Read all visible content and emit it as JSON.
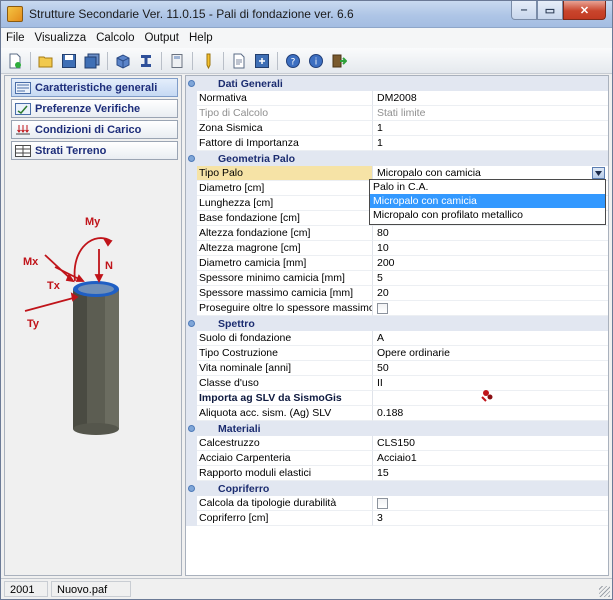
{
  "window": {
    "title": "Strutture Secondarie Ver. 11.0.15 - Pali di fondazione ver. 6.6",
    "min_label": "‒",
    "max_label": "▭",
    "close_label": "✕"
  },
  "menu": [
    "File",
    "Visualizza",
    "Calcolo",
    "Output",
    "Help"
  ],
  "toolbar_icons": [
    "new-file-icon",
    "open-folder-icon",
    "save-icon",
    "save-all-icon",
    "3d-view-icon",
    "beam-section-icon",
    "calculator-icon",
    "pencil-icon",
    "report-icon",
    "export-icon",
    "help-icon",
    "info-icon",
    "exit-icon"
  ],
  "nav": {
    "items": [
      {
        "label": "Caratteristiche generali",
        "icon": "general-icon"
      },
      {
        "label": "Preferenze Verifiche",
        "icon": "preferences-icon"
      },
      {
        "label": "Condizioni di Carico",
        "icon": "loads-icon"
      },
      {
        "label": "Strati Terreno",
        "icon": "soil-layers-icon"
      }
    ]
  },
  "drawing": {
    "labels": {
      "my": "My",
      "mx": "Mx",
      "n": "N",
      "tx": "Tx",
      "ty": "Ty"
    },
    "arrow_color": "#c0141a",
    "pile_color": "#5a5a50",
    "pile_top_color": "#2a6fd1"
  },
  "grid": {
    "dati_generali": {
      "title": "Dati Generali",
      "rows": [
        {
          "name": "Normativa",
          "value": "DM2008"
        },
        {
          "name": "Tipo di Calcolo",
          "value": "Stati limite"
        },
        {
          "name": "Zona Sismica",
          "value": "1"
        },
        {
          "name": "Fattore di Importanza",
          "value": "1"
        }
      ]
    },
    "geometria_palo": {
      "title": "Geometria Palo",
      "tipo_palo": {
        "name": "Tipo Palo",
        "value": "Micropalo con camicia"
      },
      "rows": [
        {
          "name": "Diametro [cm]",
          "value": ""
        },
        {
          "name": "Lunghezza [cm]",
          "value": ""
        },
        {
          "name": "Base fondazione [cm]",
          "value": ""
        },
        {
          "name": "Altezza fondazione [cm]",
          "value": "80"
        },
        {
          "name": "Altezza magrone [cm]",
          "value": "10"
        },
        {
          "name": "Diametro camicia [mm]",
          "value": "200"
        },
        {
          "name": "Spessore minimo camicia [mm]",
          "value": "5"
        },
        {
          "name": "Spessore massimo camicia [mm]",
          "value": "20"
        }
      ],
      "proseguire": {
        "name": "Proseguire oltre lo spessore massimo"
      }
    },
    "dropdown_options": [
      "Palo in C.A.",
      "Micropalo con camicia",
      "Micropalo con profilato metallico"
    ],
    "spettro": {
      "title": "Spettro",
      "rows": [
        {
          "name": "Suolo di fondazione",
          "value": "A"
        },
        {
          "name": "Tipo Costruzione",
          "value": "Opere ordinarie"
        },
        {
          "name": "Vita nominale [anni]",
          "value": "50"
        },
        {
          "name": "Classe d'uso",
          "value": "II"
        }
      ],
      "importa": {
        "name": "Importa ag SLV da SismoGis",
        "value": ""
      },
      "aliquota": {
        "name": "Aliquota acc. sism. (Ag) SLV",
        "value": "0.188"
      }
    },
    "materiali": {
      "title": "Materiali",
      "rows": [
        {
          "name": "Calcestruzzo",
          "value": "CLS150"
        },
        {
          "name": "Acciaio Carpenteria",
          "value": "Acciaio1"
        },
        {
          "name": "Rapporto moduli elastici",
          "value": "15"
        }
      ]
    },
    "copriferro": {
      "title": "Copriferro",
      "calcola": {
        "name": "Calcola da tipologie durabilità"
      },
      "copriferro": {
        "name": "Copriferro [cm]",
        "value": "3"
      }
    }
  },
  "status": {
    "code": "2001",
    "file": "Nuovo.paf"
  }
}
